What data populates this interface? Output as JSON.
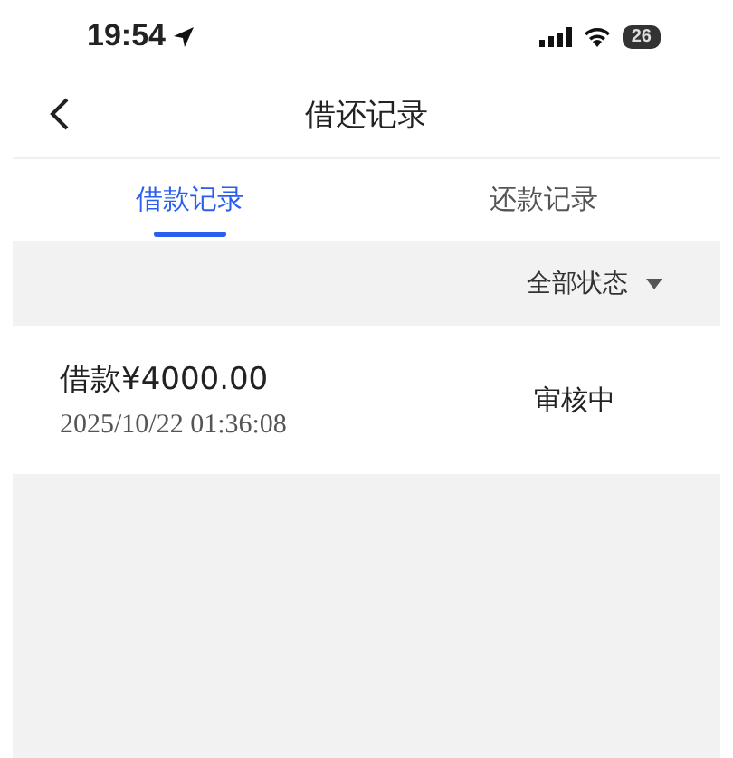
{
  "status_bar": {
    "time": "19:54",
    "battery": "26"
  },
  "nav": {
    "title": "借还记录"
  },
  "tabs": [
    {
      "label": "借款记录",
      "selected": true
    },
    {
      "label": "还款记录",
      "selected": false
    }
  ],
  "filter": {
    "label": "全部状态"
  },
  "records": [
    {
      "title": "借款¥4000.00",
      "time": "2025/10/22 01:36:08",
      "status": "审核中"
    }
  ]
}
